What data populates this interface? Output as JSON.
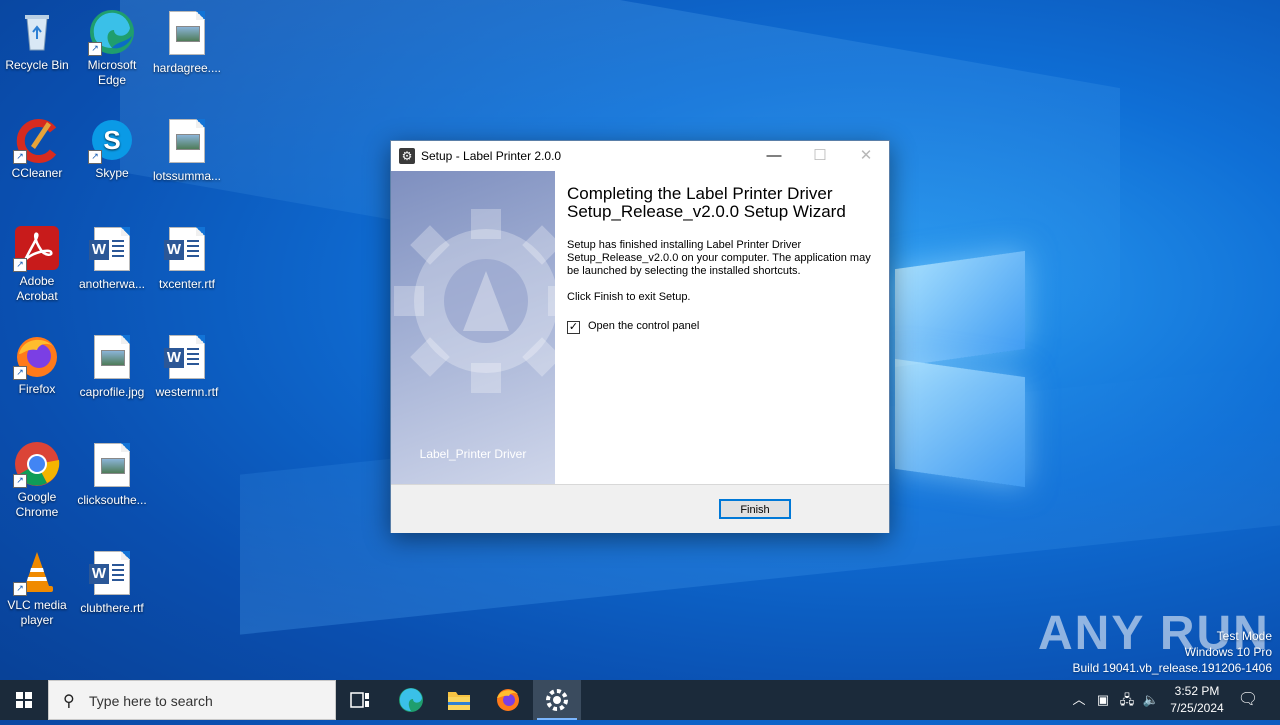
{
  "desktop": {
    "icons": [
      {
        "label": "Recycle Bin",
        "icon": "recycle-bin-icon"
      },
      {
        "label": "Microsoft Edge",
        "icon": "edge-icon"
      },
      {
        "label": "hardagree....",
        "icon": "image-file-icon"
      },
      {
        "label": "CCleaner",
        "icon": "ccleaner-icon"
      },
      {
        "label": "Skype",
        "icon": "skype-icon"
      },
      {
        "label": "lotssumma...",
        "icon": "image-file-icon"
      },
      {
        "label": "Adobe Acrobat",
        "icon": "acrobat-icon"
      },
      {
        "label": "anotherwa...",
        "icon": "word-file-icon"
      },
      {
        "label": "txcenter.rtf",
        "icon": "word-file-icon"
      },
      {
        "label": "Firefox",
        "icon": "firefox-icon"
      },
      {
        "label": "caprofile.jpg",
        "icon": "image-file-icon"
      },
      {
        "label": "westernn.rtf",
        "icon": "word-file-icon"
      },
      {
        "label": "Google Chrome",
        "icon": "chrome-icon"
      },
      {
        "label": "clicksouthe...",
        "icon": "image-file-icon"
      },
      {
        "label": "VLC media player",
        "icon": "vlc-icon"
      },
      {
        "label": "clubthere.rtf",
        "icon": "word-file-icon"
      }
    ]
  },
  "dialog": {
    "title": "Setup - Label Printer 2.0.0",
    "side_label": "Label_Printer Driver",
    "heading": "Completing the Label Printer Driver Setup_Release_v2.0.0 Setup Wizard",
    "message": "Setup has finished installing Label Printer Driver Setup_Release_v2.0.0 on your computer. The application may be launched by selecting the installed shortcuts.",
    "instruction": "Click Finish to exit Setup.",
    "checkbox_label": "Open the control panel",
    "checkbox_checked": true,
    "finish_label": "Finish",
    "controls": {
      "minimize": "—",
      "maximize": "☐",
      "close": "✕"
    }
  },
  "watermark": {
    "brand": "ANY RUN",
    "line1": "Test Mode",
    "line2": "Windows 10 Pro",
    "line3": "Build 19041.vb_release.191206-1406"
  },
  "taskbar": {
    "search_placeholder": "Type here to search",
    "time": "3:52 PM",
    "date": "7/25/2024",
    "accent": "#0078d7"
  }
}
